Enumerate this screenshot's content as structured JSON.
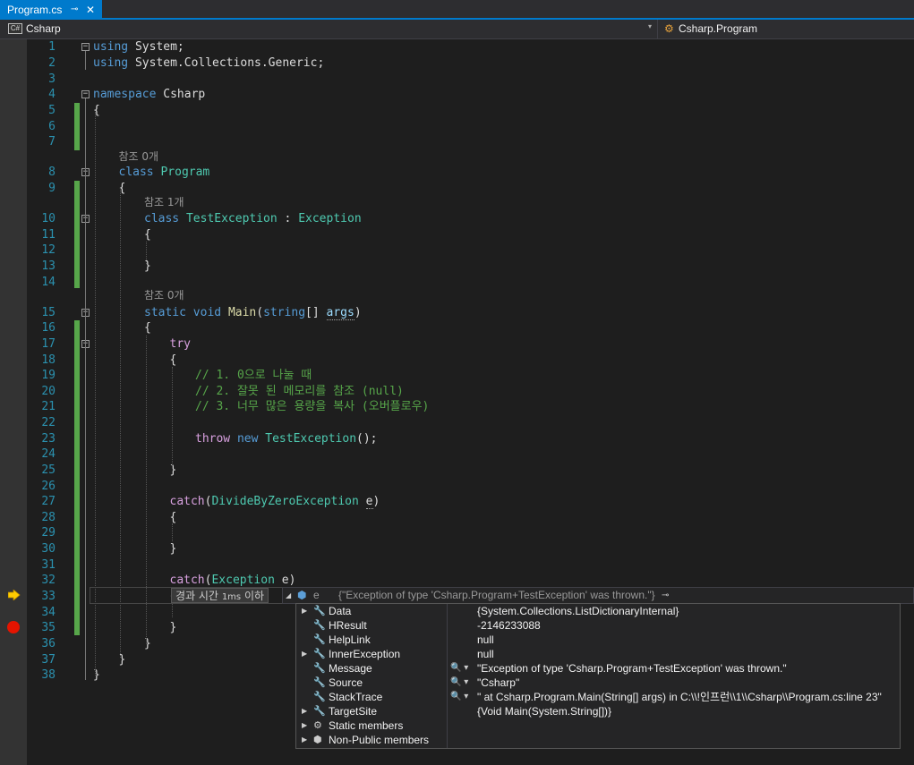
{
  "tab": {
    "title": "Program.cs",
    "pin": "⊸",
    "close": "✕"
  },
  "navbar": {
    "project_icon": "C#",
    "project": "Csharp",
    "dropdown": "▾",
    "class_icon": "⚙",
    "class": "Csharp.Program"
  },
  "lines": [
    {
      "n": "1",
      "t": "using System;"
    },
    {
      "n": "2",
      "t": "using System.Collections.Generic;"
    },
    {
      "n": "3",
      "t": ""
    },
    {
      "n": "4",
      "t": "namespace Csharp"
    },
    {
      "n": "5",
      "t": "{"
    },
    {
      "n": "6",
      "t": ""
    },
    {
      "n": "7",
      "t": ""
    },
    {
      "n": "8",
      "t": "class Program"
    },
    {
      "n": "9",
      "t": "{"
    },
    {
      "n": "10",
      "t": "class TestException : Exception"
    },
    {
      "n": "11",
      "t": "{"
    },
    {
      "n": "12",
      "t": ""
    },
    {
      "n": "13",
      "t": "}"
    },
    {
      "n": "14",
      "t": ""
    },
    {
      "n": "15",
      "t": "static void Main(string[] args)"
    },
    {
      "n": "16",
      "t": "{"
    },
    {
      "n": "17",
      "t": "try"
    },
    {
      "n": "18",
      "t": "{"
    },
    {
      "n": "19",
      "t": "// 1. 0으로 나눌 때"
    },
    {
      "n": "20",
      "t": "// 2. 잘못 된 메모리를 참조 (null)"
    },
    {
      "n": "21",
      "t": "// 3. 너무 많은 용량을 복사 (오버플로우)"
    },
    {
      "n": "22",
      "t": ""
    },
    {
      "n": "23",
      "t": "throw new TestException();"
    },
    {
      "n": "24",
      "t": ""
    },
    {
      "n": "25",
      "t": "}"
    },
    {
      "n": "26",
      "t": ""
    },
    {
      "n": "27",
      "t": "catch(DivideByZeroException e)"
    },
    {
      "n": "28",
      "t": "{"
    },
    {
      "n": "29",
      "t": ""
    },
    {
      "n": "30",
      "t": "}"
    },
    {
      "n": "31",
      "t": ""
    },
    {
      "n": "32",
      "t": "catch(Exception e)"
    },
    {
      "n": "33",
      "t": "{"
    },
    {
      "n": "34",
      "t": ""
    },
    {
      "n": "35",
      "t": "}"
    },
    {
      "n": "36",
      "t": "}"
    },
    {
      "n": "37",
      "t": "}"
    },
    {
      "n": "38",
      "t": "}"
    }
  ],
  "lens": {
    "program": "참조 0개",
    "test_exception": "참조 1개",
    "main": "참조 0개"
  },
  "elapsed": {
    "a": "경과 시간",
    "b": "1ms",
    "c": "이하"
  },
  "datatip": {
    "name": "e",
    "value": "{\"Exception of type 'Csharp.Program+TestException' was thrown.\"}",
    "pin": "⊸",
    "rows": [
      {
        "name": "Data",
        "value": "{System.Collections.ListDictionaryInternal}",
        "expandable": true,
        "viz": ""
      },
      {
        "name": "HResult",
        "value": "-2146233088",
        "expandable": false,
        "viz": ""
      },
      {
        "name": "HelpLink",
        "value": "null",
        "expandable": false,
        "viz": ""
      },
      {
        "name": "InnerException",
        "value": "null",
        "expandable": true,
        "viz": ""
      },
      {
        "name": "Message",
        "value": "\"Exception of type 'Csharp.Program+TestException' was thrown.\"",
        "expandable": false,
        "viz": "🔍 ▾"
      },
      {
        "name": "Source",
        "value": "\"Csharp\"",
        "expandable": false,
        "viz": "🔍 ▾"
      },
      {
        "name": "StackTrace",
        "value": "\"   at Csharp.Program.Main(String[] args) in C:\\\\!인프런\\\\1\\\\Csharp\\\\Program.cs:line 23\"",
        "expandable": false,
        "viz": "🔍 ▾"
      },
      {
        "name": "TargetSite",
        "value": "{Void Main(System.String[])}",
        "expandable": true,
        "viz": ""
      },
      {
        "name": "Static members",
        "value": "",
        "expandable": true,
        "viz": ""
      },
      {
        "name": "Non-Public members",
        "value": "",
        "expandable": true,
        "viz": ""
      }
    ]
  },
  "colors": {
    "accent": "#007acc",
    "keyword": "#569cd6",
    "type": "#4ec9b0",
    "control": "#d8a0df",
    "comment": "#57a64a",
    "breakpoint": "#e51400",
    "execution": "#ffcc00"
  }
}
